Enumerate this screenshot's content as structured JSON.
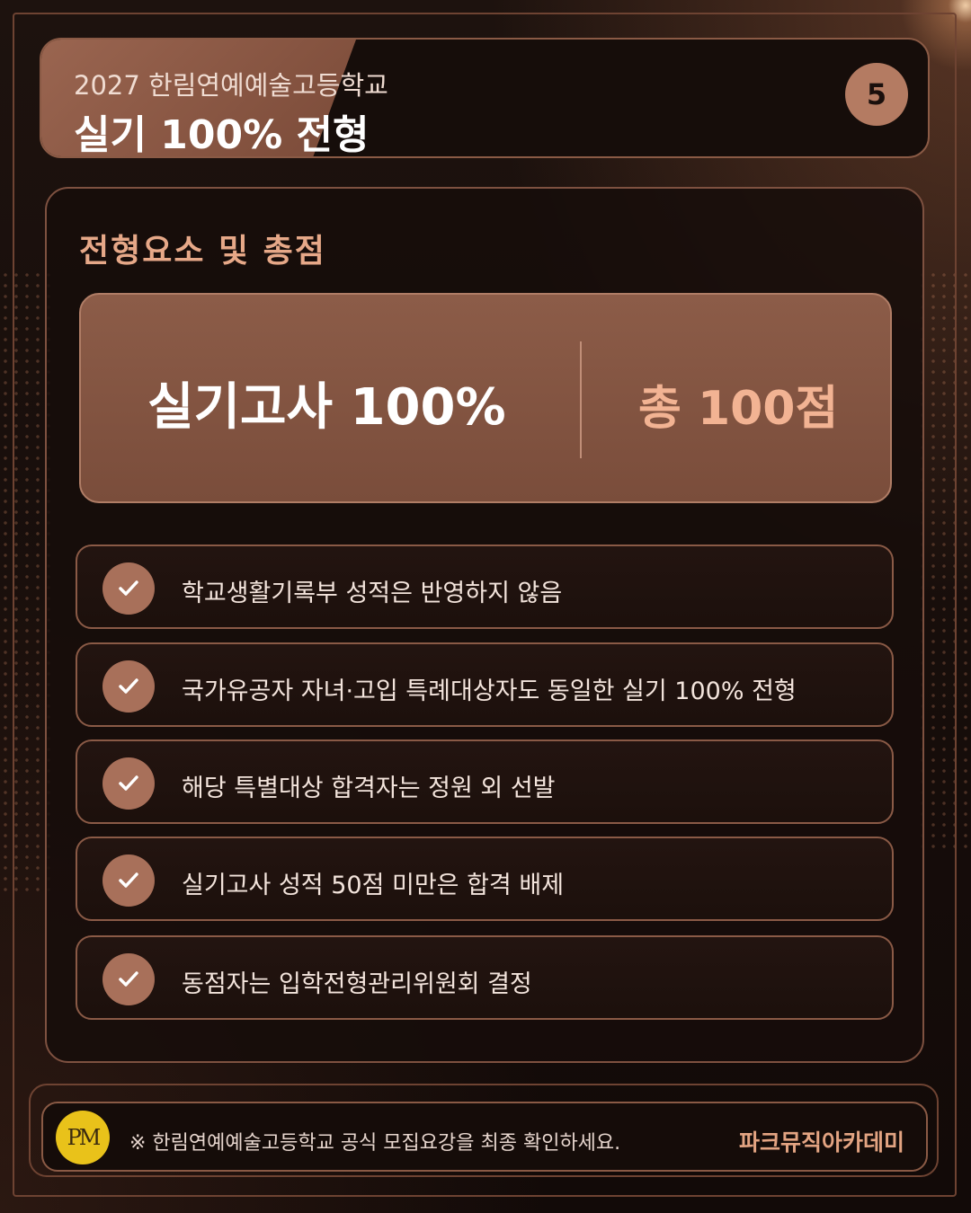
{
  "header": {
    "subtitle": "2027 한림연예예술고등학교",
    "title": "실기 100% 전형",
    "page_number": "5"
  },
  "section": {
    "title": "전형요소 및 총점"
  },
  "score": {
    "left": "실기고사 100%",
    "right": "총 100점"
  },
  "items": [
    "학교생활기록부 성적은 반영하지 않음",
    "국가유공자 자녀·고입 특례대상자도 동일한 실기 100% 전형",
    "해당 특별대상 합격자는 정원 외 선발",
    "실기고사 성적 50점 미만은 합격 배제",
    "동점자는 입학전형관리위원회 결정"
  ],
  "footer": {
    "logo_text": "PM",
    "note": "※ 한림연예예술고등학교 공식 모집요강을 최종 확인하세요.",
    "brand": "파크뮤직아카데미"
  },
  "colors": {
    "accent": "#a8705a",
    "highlight": "#e6a888",
    "background": "#1a0f0c"
  }
}
